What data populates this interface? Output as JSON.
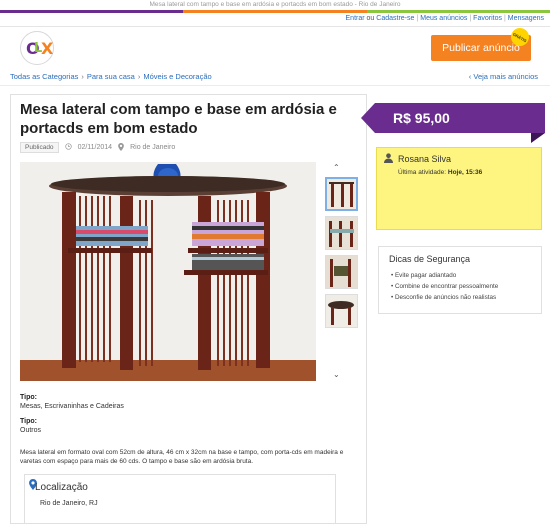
{
  "window": {
    "title": "Mesa lateral com tampo e base em ardósia e portacds em bom estado - Rio de Janeiro"
  },
  "colors": {
    "brand_purple": "#6a2c8f",
    "orange": "#f58220",
    "green": "#8cc63f",
    "seller_bg": "#fef580"
  },
  "header": {
    "links": {
      "login": "Entrar",
      "or": "ou",
      "register": "Cadastre-se",
      "my_ads": "Meus anúncios",
      "favorites": "Favoritos",
      "messages": "Mensagens"
    },
    "logo": {
      "o": "O",
      "l": "L",
      "x": "X"
    },
    "post_button": "Publicar anúncio",
    "gratis_badge": "GRÁTIS"
  },
  "breadcrumb": {
    "items": [
      "Todas as Categorias",
      "Para sua casa",
      "Móveis e Decoração"
    ],
    "separator": "›",
    "see_more": "Veja mais anúncios",
    "see_more_icon": "chevron-left-icon"
  },
  "ad": {
    "title": "Mesa lateral com tampo e base em ardósia e portacds em bom estado",
    "status": "Publicado",
    "date": "02/11/2014",
    "location": "Rio de Janeiro",
    "specs": [
      {
        "label": "Tipo:",
        "value": "Mesas, Escrivaninhas e Cadeiras"
      },
      {
        "label": "Tipo:",
        "value": "Outros"
      }
    ],
    "description": "Mesa lateral em formato oval com 52cm de altura, 46 cm x 32cm na base e tampo, com porta-cds em madeira e varetas com espaço para mais de 60 cds. O tampo e base são em ardósia bruta.",
    "location_box": {
      "title": "Localização",
      "city": "Rio de Janeiro, RJ"
    }
  },
  "price": "R$ 95,00",
  "seller": {
    "name": "Rosana Silva",
    "activity_label": "Última atividade:",
    "activity_value": "Hoje, 15:36"
  },
  "safety": {
    "title": "Dicas de Segurança",
    "tips": [
      "Evite pagar adiantado",
      "Combine de encontrar pessoalmente",
      "Desconfie de anúncios não realistas"
    ]
  }
}
